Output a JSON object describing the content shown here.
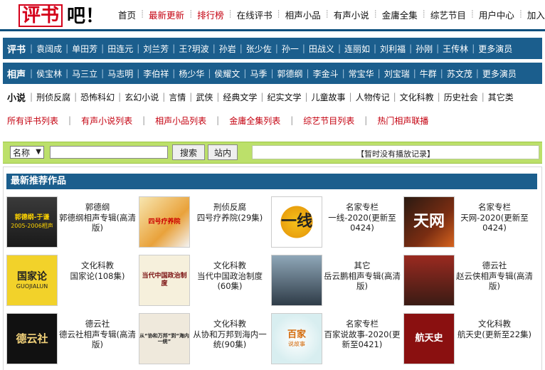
{
  "logo": {
    "part1": "评书",
    "part2": "吧！"
  },
  "topnav": [
    {
      "label": "首页",
      "hl": false
    },
    {
      "label": "最新更新",
      "hl": true
    },
    {
      "label": "排行榜",
      "hl": true
    },
    {
      "label": "在线评书",
      "hl": false
    },
    {
      "label": "相声小品",
      "hl": false
    },
    {
      "label": "有声小说",
      "hl": false
    },
    {
      "label": "金庸全集",
      "hl": false
    },
    {
      "label": "综艺节目",
      "hl": false
    },
    {
      "label": "用户中心",
      "hl": false
    },
    {
      "label": "加入收藏",
      "hl": false
    }
  ],
  "pingshu": {
    "head": "评书",
    "items": [
      "袁阔成",
      "单田芳",
      "田连元",
      "刘兰芳",
      "王?玥波",
      "孙岩",
      "张少佐",
      "孙一",
      "田战义",
      "连丽如",
      "刘利福",
      "孙刚",
      "王传林",
      "更多演员"
    ]
  },
  "xiangsheng": {
    "head": "相声",
    "items": [
      "侯宝林",
      "马三立",
      "马志明",
      "李伯祥",
      "杨少华",
      "侯耀文",
      "马季",
      "郭德纲",
      "李金斗",
      "常宝华",
      "刘宝瑞",
      "牛群",
      "苏文茂",
      "更多演员"
    ]
  },
  "xiaoshuo": {
    "head": "小说",
    "items": [
      "刑侦反腐",
      "恐怖科幻",
      "玄幻小说",
      "言情",
      "武侠",
      "经典文学",
      "纪实文学",
      "儿童故事",
      "人物传记",
      "文化科教",
      "历史社会",
      "其它类"
    ]
  },
  "lists": [
    "所有评书列表",
    "有声小说列表",
    "相声小品列表",
    "金庸全集列表",
    "综艺节目列表",
    "热门相声联播"
  ],
  "search": {
    "select_value": "名称",
    "input_value": "",
    "search_button": "搜索",
    "site_button": "站内",
    "play_record": "【暂时没有播放记录】"
  },
  "works": {
    "title": "最新推荐作品",
    "items": [
      {
        "category": "郭德纲",
        "title": "郭德纲相声专辑(高清版)",
        "thumb": "thumb-guodegang",
        "cap": "郭德纲-于谦",
        "cap2": "2005-2006相声"
      },
      {
        "category": "刑侦反腐",
        "title": "四号疗养院(29集)",
        "thumb": "thumb-sihao",
        "cap": "四号疗养院",
        "cap2": ""
      },
      {
        "category": "名家专栏",
        "title": "一线-2020(更新至0424)",
        "thumb": "thumb-yixian",
        "cap": "一线",
        "cap2": ""
      },
      {
        "category": "名家专栏",
        "title": "天网-2020(更新至0424)",
        "thumb": "thumb-tianwang",
        "cap": "天网",
        "cap2": ""
      },
      {
        "category": "文化科教",
        "title": "国家论(108集)",
        "thumb": "thumb-guojialun",
        "cap": "国家论",
        "cap2": "GUOJIALUN"
      },
      {
        "category": "文化科教",
        "title": "当代中国政治制度(60集)",
        "thumb": "thumb-zhengzhi",
        "cap": "当代中国政治制度",
        "cap2": ""
      },
      {
        "category": "其它",
        "title": "岳云鹏相声专辑(高清版)",
        "thumb": "thumb-yueyunpeng",
        "cap": "",
        "cap2": ""
      },
      {
        "category": "德云社",
        "title": "赵云侠相声专辑(高清版)",
        "thumb": "thumb-zhaoyunxia",
        "cap": "",
        "cap2": ""
      },
      {
        "category": "德云社",
        "title": "德云社相声专辑(高清版)",
        "thumb": "thumb-deyunshe",
        "cap": "德云社",
        "cap2": ""
      },
      {
        "category": "文化科教",
        "title": "从协和万邦到海内一统(90集)",
        "thumb": "thumb-xiehe",
        "cap": "从“协和万邦”到“海内一统”",
        "cap2": ""
      },
      {
        "category": "名家专栏",
        "title": "百家说故事-2020(更新至0421)",
        "thumb": "thumb-baijia",
        "cap": "百家",
        "cap2": "说故事"
      },
      {
        "category": "文化科教",
        "title": "航天史(更新至22集)",
        "thumb": "thumb-hangtian",
        "cap": "航天史",
        "cap2": ""
      }
    ]
  }
}
